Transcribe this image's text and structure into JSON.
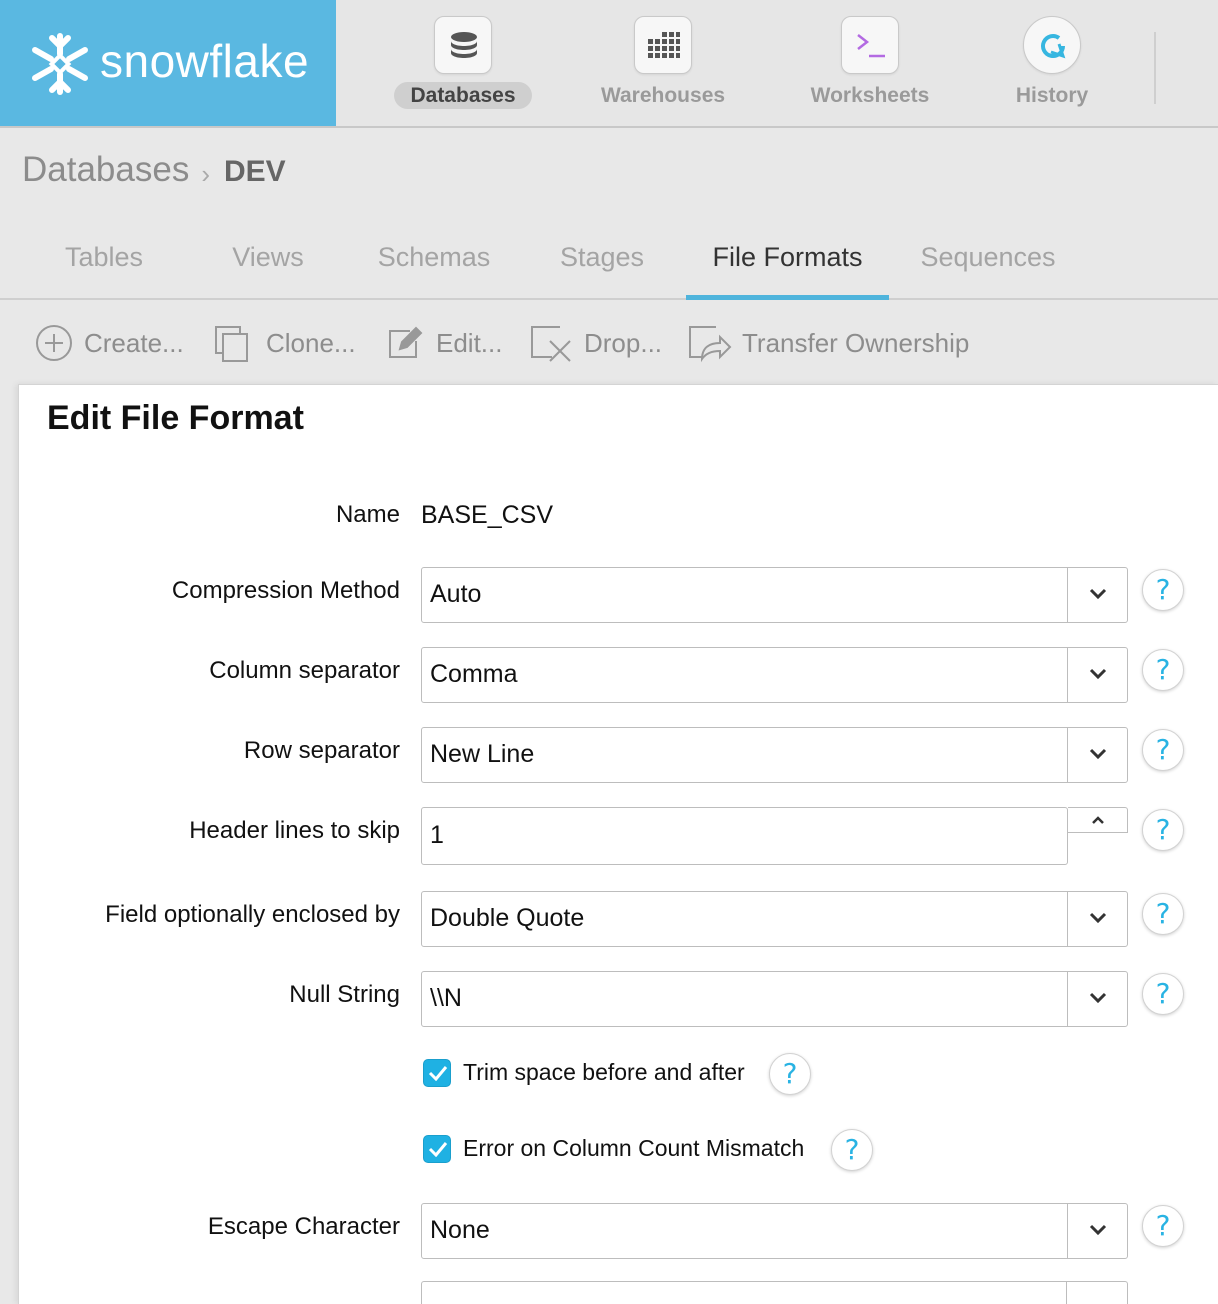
{
  "app": {
    "brand": "snowflake",
    "brand_color": "#5ab8e1",
    "accent_color": "#1fb1e3"
  },
  "nav": {
    "items": [
      {
        "label": "Databases",
        "icon": "database-icon",
        "active": true
      },
      {
        "label": "Warehouses",
        "icon": "warehouse-grid-icon",
        "active": false
      },
      {
        "label": "Worksheets",
        "icon": "terminal-icon",
        "active": false
      },
      {
        "label": "History",
        "icon": "history-refresh-icon",
        "active": false
      }
    ]
  },
  "breadcrumb": {
    "root": "Databases",
    "separator": "›",
    "current": "DEV"
  },
  "tabs": [
    {
      "label": "Tables"
    },
    {
      "label": "Views"
    },
    {
      "label": "Schemas"
    },
    {
      "label": "Stages"
    },
    {
      "label": "File Formats",
      "active": true
    },
    {
      "label": "Sequences"
    }
  ],
  "toolbar": {
    "create": "Create...",
    "clone": "Clone...",
    "edit": "Edit...",
    "drop": "Drop...",
    "transfer": "Transfer Ownership"
  },
  "dialog": {
    "title": "Edit File Format",
    "help_glyph": "?",
    "name_label": "Name",
    "name_value": "BASE_CSV",
    "compression_label": "Compression Method",
    "compression_value": "Auto",
    "column_sep_label": "Column separator",
    "column_sep_value": "Comma",
    "row_sep_label": "Row separator",
    "row_sep_value": "New Line",
    "header_skip_label": "Header lines to skip",
    "header_skip_value": "1",
    "enclosed_label": "Field optionally enclosed by",
    "enclosed_value": "Double Quote",
    "null_label": "Null String",
    "null_value": "\\\\N",
    "trim_label": "Trim space before and after",
    "trim_checked": true,
    "error_label": "Error on Column Count Mismatch",
    "error_checked": true,
    "escape_label": "Escape Character",
    "escape_value": "None"
  }
}
